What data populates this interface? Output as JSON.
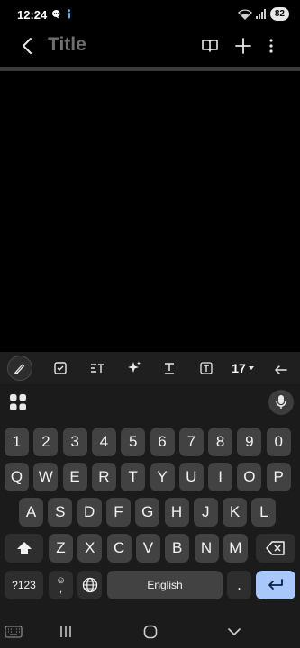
{
  "status": {
    "time": "12:24",
    "battery": "82"
  },
  "header": {
    "title": "Title"
  },
  "toolbar": {
    "font_size": "17"
  },
  "keyboard": {
    "row_numbers": [
      "1",
      "2",
      "3",
      "4",
      "5",
      "6",
      "7",
      "8",
      "9",
      "0"
    ],
    "row_top": [
      "Q",
      "W",
      "E",
      "R",
      "T",
      "Y",
      "U",
      "I",
      "O",
      "P"
    ],
    "row_mid": [
      "A",
      "S",
      "D",
      "F",
      "G",
      "H",
      "J",
      "K",
      "L"
    ],
    "row_bottom": [
      "Z",
      "X",
      "C",
      "V",
      "B",
      "N",
      "M"
    ],
    "sym_label": "?123",
    "emoji_label": "☺",
    "comma_label": ",",
    "space_label": "English",
    "period_label": "."
  },
  "colors": {
    "accent": "#a8c7fa",
    "key": "#424242",
    "key_dark": "#2e2e2e"
  }
}
